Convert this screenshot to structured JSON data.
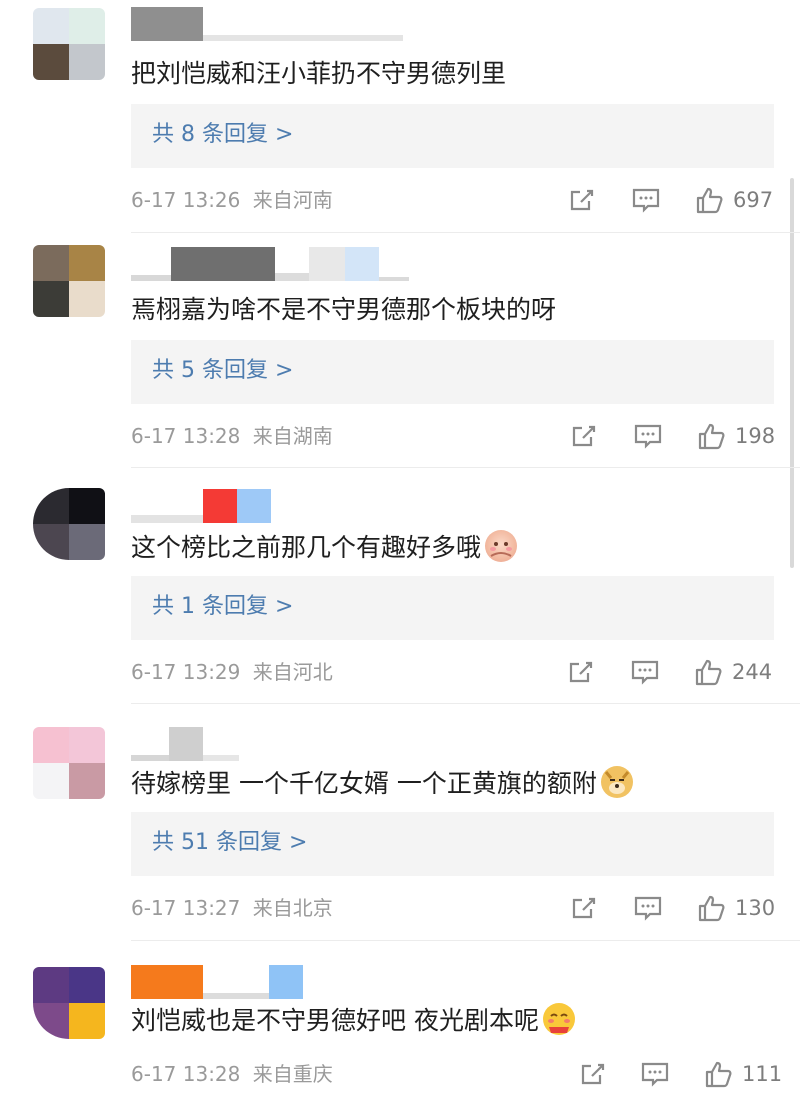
{
  "comments": [
    {
      "text": "把刘恺威和汪小菲扔不守男德列里",
      "replies": "共 8 条回复 >",
      "time": "6-17 13:26",
      "location": "来自河南",
      "likes": "697",
      "avatar_colors": [
        "#e0e7ee",
        "#dfeee8",
        "#5b4b3d",
        "#c3c7cc"
      ]
    },
    {
      "text": "焉栩嘉为啥不是不守男德那个板块的呀",
      "replies": "共 5 条回复 >",
      "time": "6-17 13:28",
      "location": "来自湖南",
      "likes": "198",
      "avatar_colors": [
        "#7b6b5c",
        "#a88446",
        "#3c3c37",
        "#e9dccb"
      ]
    },
    {
      "text": "这个榜比之前那几个有趣好多哦",
      "replies": "共 1 条回复 >",
      "time": "6-17 13:29",
      "location": "来自河北",
      "likes": "244",
      "avatar_colors": [
        "#2b2a30",
        "#101015",
        "#4c4650",
        "#6b6a78"
      ]
    },
    {
      "text": "待嫁榜里 一个千亿女婿 一个正黄旗的额附",
      "replies": "共 51 条回复 >",
      "time": "6-17 13:27",
      "location": "来自北京",
      "likes": "130",
      "avatar_colors": [
        "#f6c1d1",
        "#f3c6d8",
        "#f4f4f6",
        "#c99aa4"
      ]
    },
    {
      "text": "刘恺威也是不守男德好吧 夜光剧本呢",
      "time": "6-17 13:28",
      "location": "来自重庆",
      "likes": "111",
      "avatar_colors": [
        "#5d3a82",
        "#4a3687",
        "#7d4a8a",
        "#f5b61e"
      ]
    }
  ],
  "icons": {
    "share": "share-icon",
    "comment": "comment-icon",
    "like": "thumbs-up-icon",
    "emoji_3": "shy-face-emoji-icon",
    "emoji_4": "doge-emoji-icon",
    "emoji_5": "smirk-face-emoji-icon"
  },
  "colors": {
    "reply_link": "#4d7caf",
    "meta_text": "#9a9a9a",
    "reply_bg": "#f4f4f4"
  }
}
